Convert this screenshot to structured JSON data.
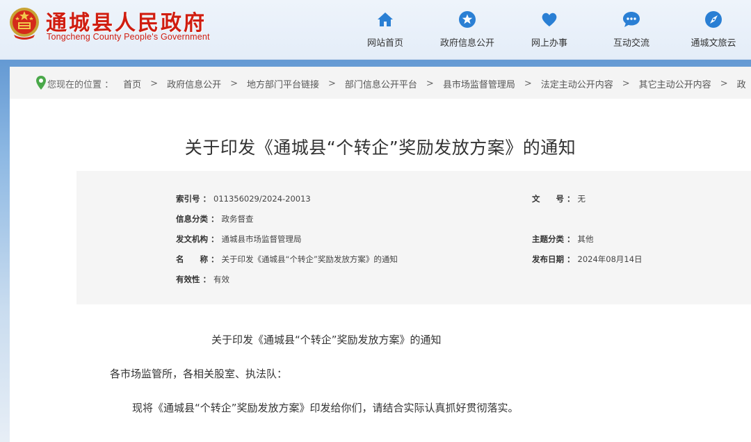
{
  "header": {
    "site_title": "通城县人民政府",
    "site_subtitle": "Tongcheng County People's Government",
    "nav": [
      {
        "label": "网站首页",
        "icon": "home-icon"
      },
      {
        "label": "政府信息公开",
        "icon": "star-icon"
      },
      {
        "label": "网上办事",
        "icon": "heart-icon"
      },
      {
        "label": "互动交流",
        "icon": "chat-icon"
      },
      {
        "label": "通城文旅云",
        "icon": "compass-icon"
      }
    ]
  },
  "breadcrumb": {
    "lead": "您现在的位置 ：",
    "items": [
      "首页",
      "政府信息公开",
      "地方部门平台链接",
      "部门信息公开平台",
      "县市场监督管理局",
      "法定主动公开内容",
      "其它主动公开内容",
      "政"
    ]
  },
  "document": {
    "title": "关于印发《通城县“个转企”奖励发放方案》的通知",
    "meta": {
      "index_label": "索引号 ：",
      "index_value": "011356029/2024-20013",
      "doc_no_label": "文　　号 ：",
      "doc_no_value": "无",
      "category_label": "信息分类 ：",
      "category_value": "政务督查",
      "issuer_label": "发文机构 ：",
      "issuer_value": "通城县市场监督管理局",
      "topic_label": "主题分类 ：",
      "topic_value": "其他",
      "name_label": "名　　称 ：",
      "name_value": "关于印发《通城县“个转企”奖励发放方案》的通知",
      "date_label": "发布日期 ：",
      "date_value": "2024年08月14日",
      "validity_label": "有效性 ：",
      "validity_value": "有效"
    },
    "body": {
      "heading": "关于印发《通城县“个转企”奖励发放方案》的通知",
      "salutation": "各市场监管所，各相关股室、执法队：",
      "paragraph": "现将《通城县“个转企”奖励发放方案》印发给你们，请结合实际认真抓好贯彻落实。"
    }
  },
  "colors": {
    "brand_red": "#d01d10",
    "nav_icon_blue": "#2a7fd4",
    "location_green": "#4aa84a"
  }
}
